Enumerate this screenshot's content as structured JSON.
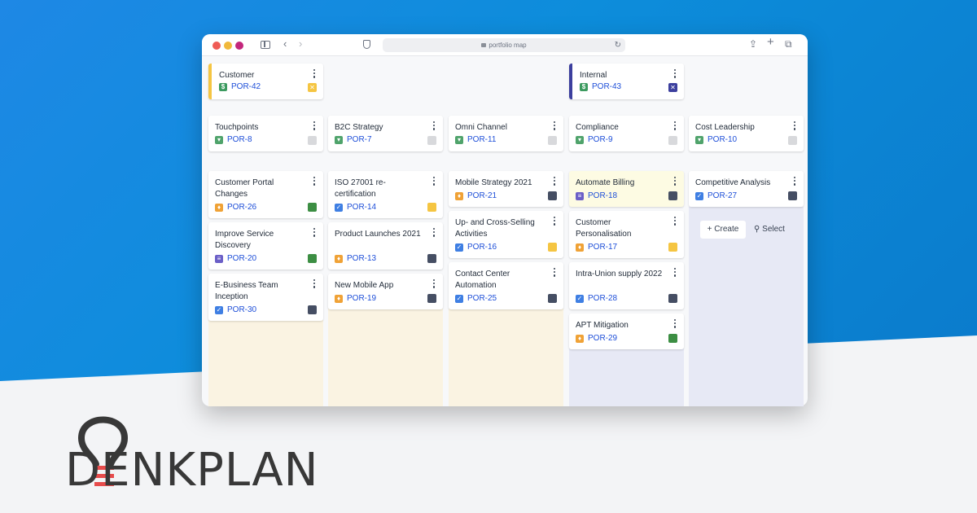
{
  "browser": {
    "url": "portfolio map",
    "reload_icon": "reload-icon"
  },
  "colors": {
    "yellow": "#f5c542",
    "navy": "#3c3f9e",
    "dark_status": "#454e63",
    "green_status": "#3c8e43",
    "grey_status": "#d8d9dc",
    "key_blue": "#1d4ed8",
    "lane_cream": "#faf3e2",
    "lane_lavender": "#e7e9f5",
    "highlight": "#fdfbe3"
  },
  "board": {
    "groups": [
      {
        "title": "Customer",
        "key": "POR-42",
        "type_icon": "dollar-icon",
        "status_icon": "close-icon"
      },
      {
        "title": "Internal",
        "key": "POR-43",
        "type_icon": "dollar-icon",
        "status_icon": "close-icon"
      }
    ],
    "columns": [
      {
        "title": "Touchpoints",
        "key": "POR-8",
        "type_icon": "bookmark-icon",
        "cards": [
          {
            "title": "Customer Portal Changes",
            "key": "POR-26",
            "type_icon": "idea-icon",
            "status": "green"
          },
          {
            "title": "Improve Service Discovery",
            "key": "POR-20",
            "type_icon": "document-icon",
            "status": "green"
          },
          {
            "title": "E-Business Team Inception",
            "key": "POR-30",
            "type_icon": "checkbox-icon",
            "status": "dark"
          }
        ]
      },
      {
        "title": "B2C Strategy",
        "key": "POR-7",
        "type_icon": "bookmark-icon",
        "cards": [
          {
            "title": "ISO 27001 re-certification",
            "key": "POR-14",
            "type_icon": "checkbox-icon",
            "status": "yellow"
          },
          {
            "title": "Product Launches 2021",
            "key": "POR-13",
            "type_icon": "idea-icon",
            "status": "dark"
          },
          {
            "title": "New Mobile App",
            "key": "POR-19",
            "type_icon": "idea-icon",
            "status": "dark"
          }
        ]
      },
      {
        "title": "Omni Channel",
        "key": "POR-11",
        "type_icon": "bookmark-icon",
        "cards": [
          {
            "title": "Mobile Strategy 2021",
            "key": "POR-21",
            "type_icon": "idea-icon",
            "status": "dark"
          },
          {
            "title": "Up- and Cross-Selling Activities",
            "key": "POR-16",
            "type_icon": "checkbox-icon",
            "status": "yellow"
          },
          {
            "title": "Contact Center Automation",
            "key": "POR-25",
            "type_icon": "checkbox-icon",
            "status": "dark"
          }
        ]
      },
      {
        "title": "Compliance",
        "key": "POR-9",
        "type_icon": "bookmark-icon",
        "cards": [
          {
            "title": "Automate Billing",
            "key": "POR-18",
            "type_icon": "document-icon",
            "status": "dark"
          },
          {
            "title": "Customer Personalisation",
            "key": "POR-17",
            "type_icon": "idea-icon",
            "status": "yellow"
          },
          {
            "title": "Intra-Union supply 2022",
            "key": "POR-28",
            "type_icon": "checkbox-icon",
            "status": "dark"
          },
          {
            "title": "APT Mitigation",
            "key": "POR-29",
            "type_icon": "idea-icon",
            "status": "green"
          }
        ]
      },
      {
        "title": "Cost Leadership",
        "key": "POR-10",
        "type_icon": "bookmark-icon",
        "cards": [
          {
            "title": "Competitive Analysis",
            "key": "POR-27",
            "type_icon": "checkbox-icon",
            "status": "dark"
          }
        ]
      }
    ],
    "actions": {
      "create": "Create",
      "select": "Select"
    }
  },
  "logo": {
    "text": "DENKPLAN"
  }
}
